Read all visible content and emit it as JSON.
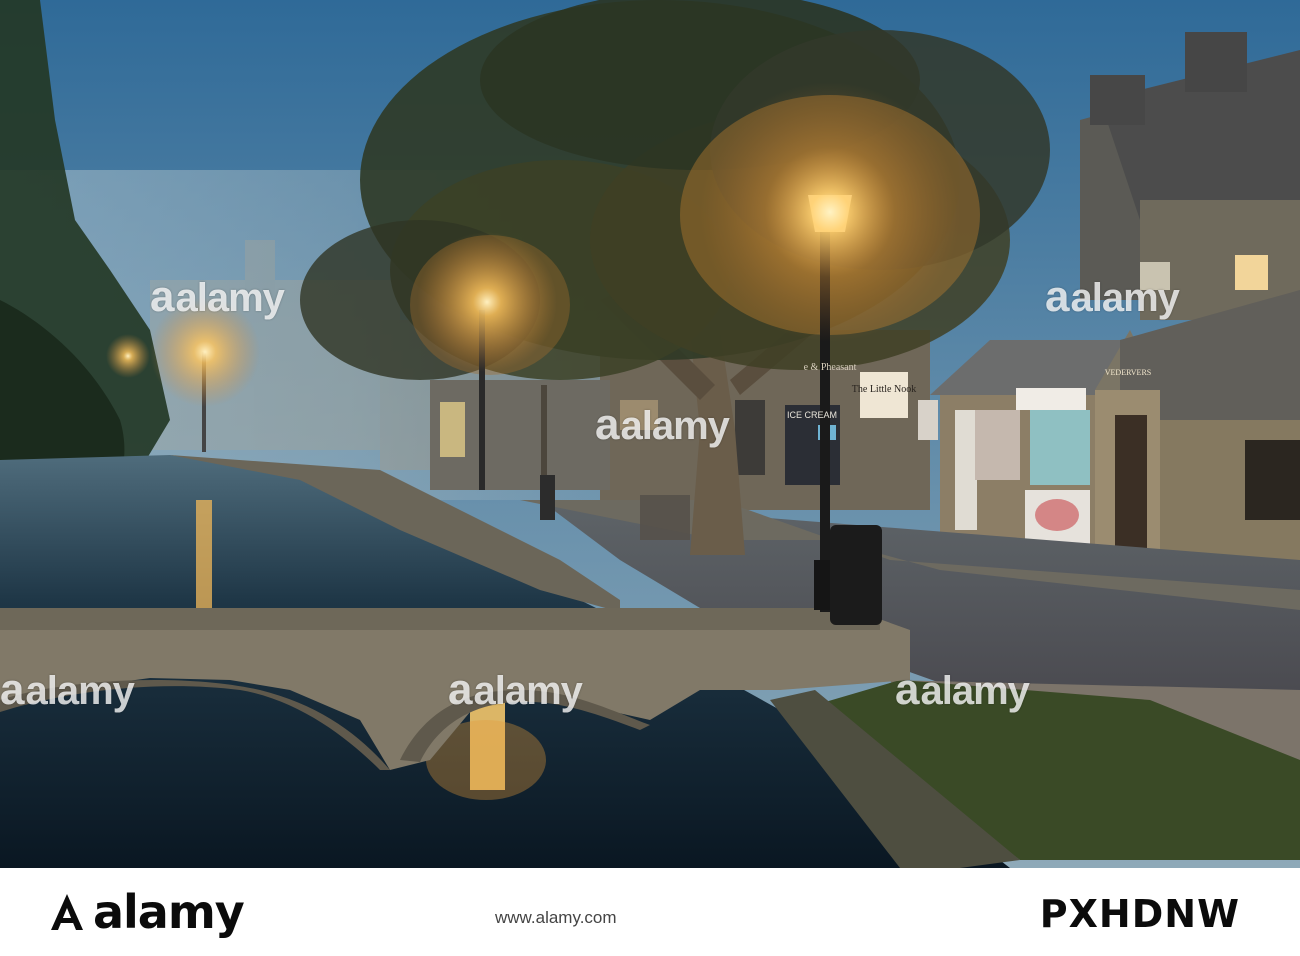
{
  "watermark": {
    "text": "alamy"
  },
  "signs": {
    "little_nook": "The Little Nook",
    "ice_cream": "ICE CREAM",
    "shop_name": "VEDERVERS",
    "pub_partial": "e & Pheasant"
  },
  "footer": {
    "logo": "alamy",
    "caption": "www.alamy.com",
    "stock_id": "PXHDNW"
  },
  "colors": {
    "sky": "#3d6f96",
    "fog": "#8fb0c4",
    "lamp": "#ffd98a",
    "water": "#0c1e2b",
    "stone": "#7d7463"
  }
}
